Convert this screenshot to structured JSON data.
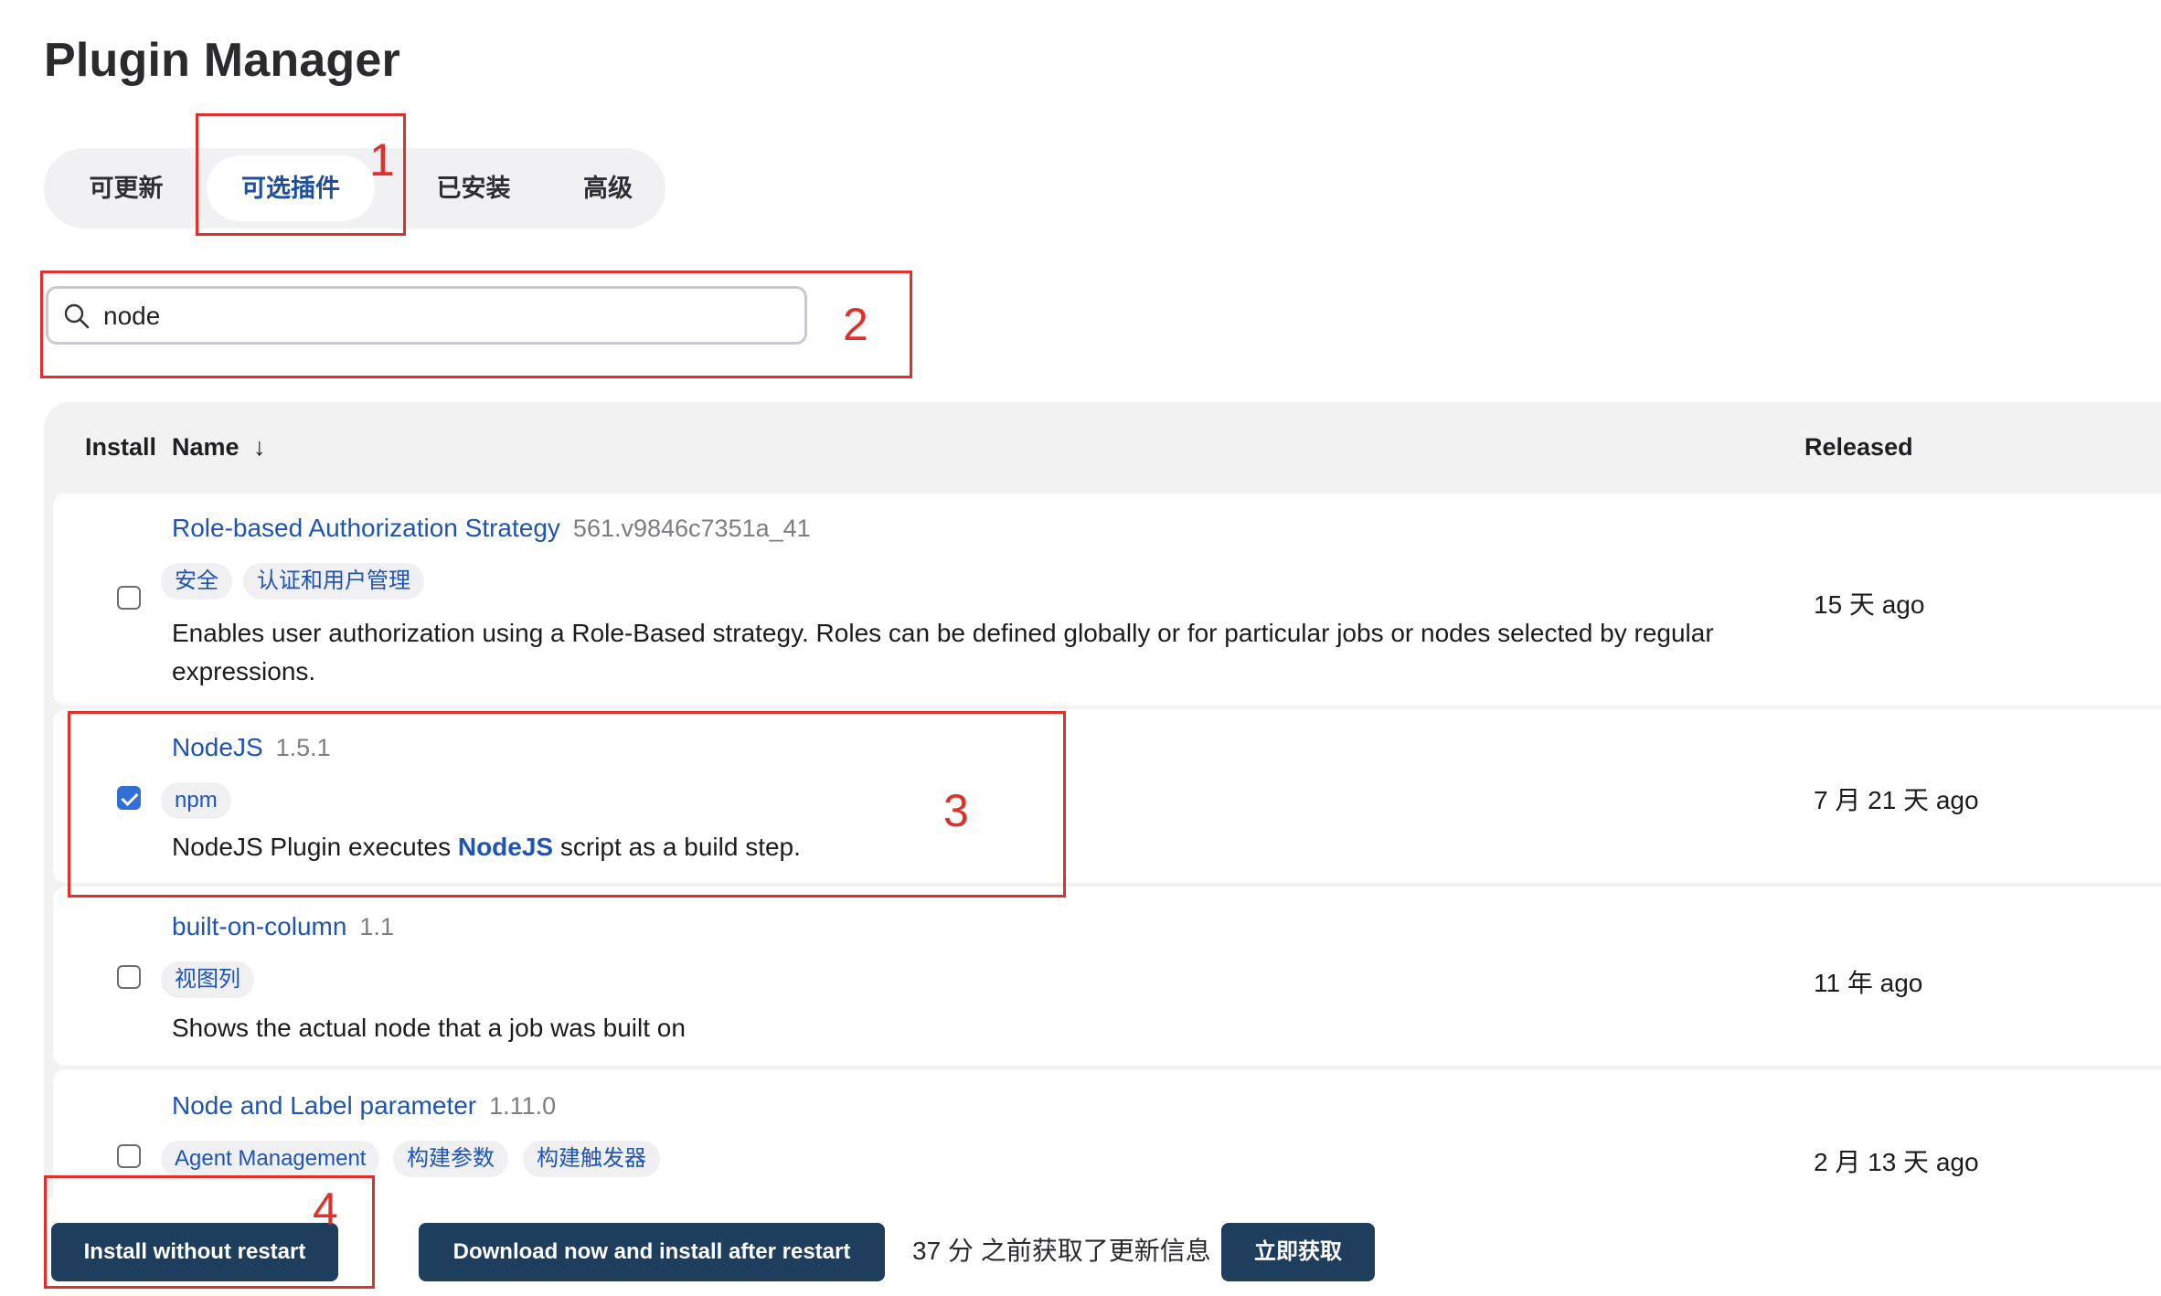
{
  "page": {
    "title": "Plugin Manager"
  },
  "tabs": [
    {
      "label": "可更新",
      "active": false
    },
    {
      "label": "可选插件",
      "active": true
    },
    {
      "label": "已安装",
      "active": false
    },
    {
      "label": "高级",
      "active": false
    }
  ],
  "search": {
    "value": "node",
    "icon": "search-icon"
  },
  "table": {
    "headers": {
      "install": "Install",
      "name": "Name",
      "sort_indicator": "↓",
      "released": "Released"
    },
    "rows": [
      {
        "name": "Role-based Authorization Strategy",
        "version": "561.v9846c7351a_41",
        "tags": [
          "安全",
          "认证和用户管理"
        ],
        "description": "Enables user authorization using a Role-Based strategy. Roles can be defined globally or for particular jobs or nodes selected by regular expressions.",
        "released": "15 天 ago",
        "checked": false
      },
      {
        "name": "NodeJS",
        "version": "1.5.1",
        "tags": [
          "npm"
        ],
        "description_before": "NodeJS Plugin executes ",
        "description_link": "NodeJS",
        "description_after": " script as a build step.",
        "released": "7 月 21 天 ago",
        "checked": true
      },
      {
        "name": "built-on-column",
        "version": "1.1",
        "tags": [
          "视图列"
        ],
        "description": "Shows the actual node that a job was built on",
        "released": "11 年 ago",
        "checked": false
      },
      {
        "name": "Node and Label parameter",
        "version": "1.11.0",
        "tags": [
          "Agent Management",
          "构建参数",
          "构建触发器"
        ],
        "released": "2 月 13 天 ago",
        "checked": false
      }
    ]
  },
  "footer": {
    "install_button": "Install without restart",
    "download_button": "Download now and install after restart",
    "update_info": "37 分 之前获取了更新信息",
    "fetch_button": "立即获取"
  },
  "annotations": [
    "1",
    "2",
    "3",
    "4"
  ],
  "colors": {
    "annotation": "#e0302b",
    "link": "#1e54b7",
    "button": "#1f3d5c",
    "checkbox_checked": "#2f6fd6"
  }
}
